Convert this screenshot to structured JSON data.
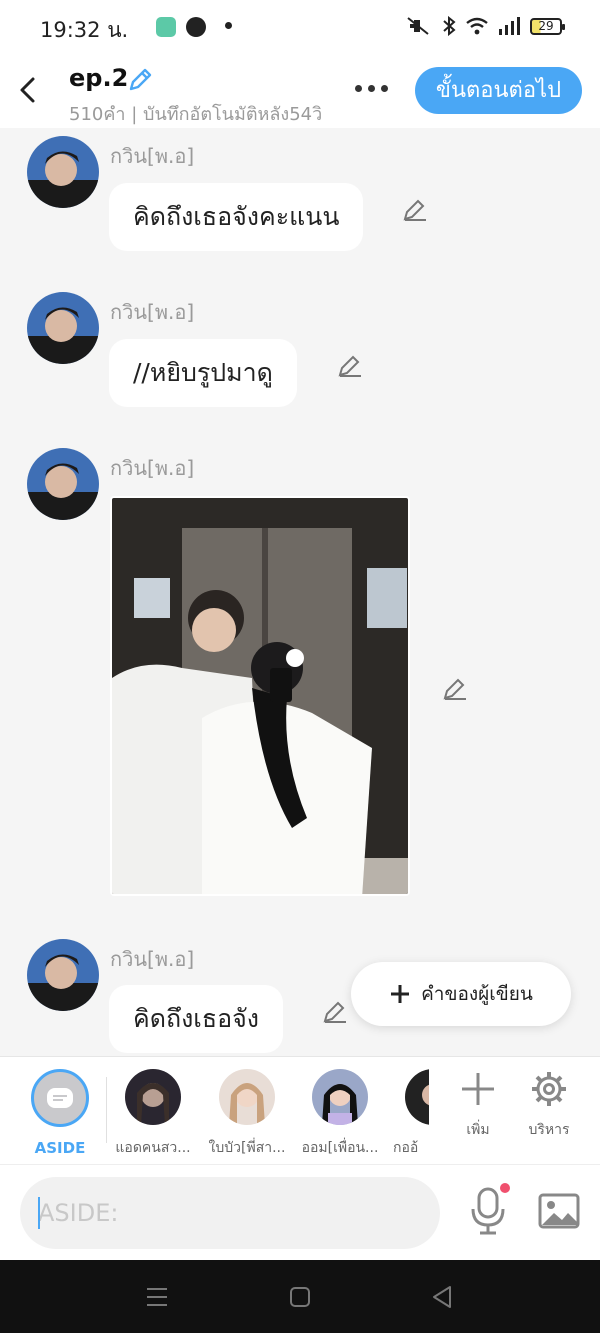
{
  "status_bar": {
    "time": "19:32 น.",
    "battery": "29"
  },
  "header": {
    "title": "ep.2",
    "subtitle": "510คำ | บันทึกอัตโนมัติหลัง54วิ",
    "next_label": "ขั้นตอนต่อไป"
  },
  "messages": [
    {
      "name": "กวิน[พ.อ]",
      "text": "คิดถึงเธอจังคะแนน"
    },
    {
      "name": "กวิน[พ.อ]",
      "text": "//หยิบรูปมาดู"
    },
    {
      "name": "กวิน[พ.อ]",
      "image": "photo"
    },
    {
      "name": "กวิน[พ.อ]",
      "text": "คิดถึงเธอจัง"
    }
  ],
  "fab": {
    "label": "คำของผู้เขียน"
  },
  "characters": [
    {
      "label": "ASIDE"
    },
    {
      "label": "แอดคนสว..."
    },
    {
      "label": "ใบบัว[พี่สา..."
    },
    {
      "label": "ออม[เพื่อน..."
    },
    {
      "label": "กออ้"
    }
  ],
  "tools": {
    "add_label": "เพิ่ม",
    "manage_label": "บริหาร"
  },
  "input": {
    "placeholder": "ASIDE:"
  },
  "colors": {
    "accent": "#4aa7f5",
    "bg": "#f5f5f5"
  }
}
